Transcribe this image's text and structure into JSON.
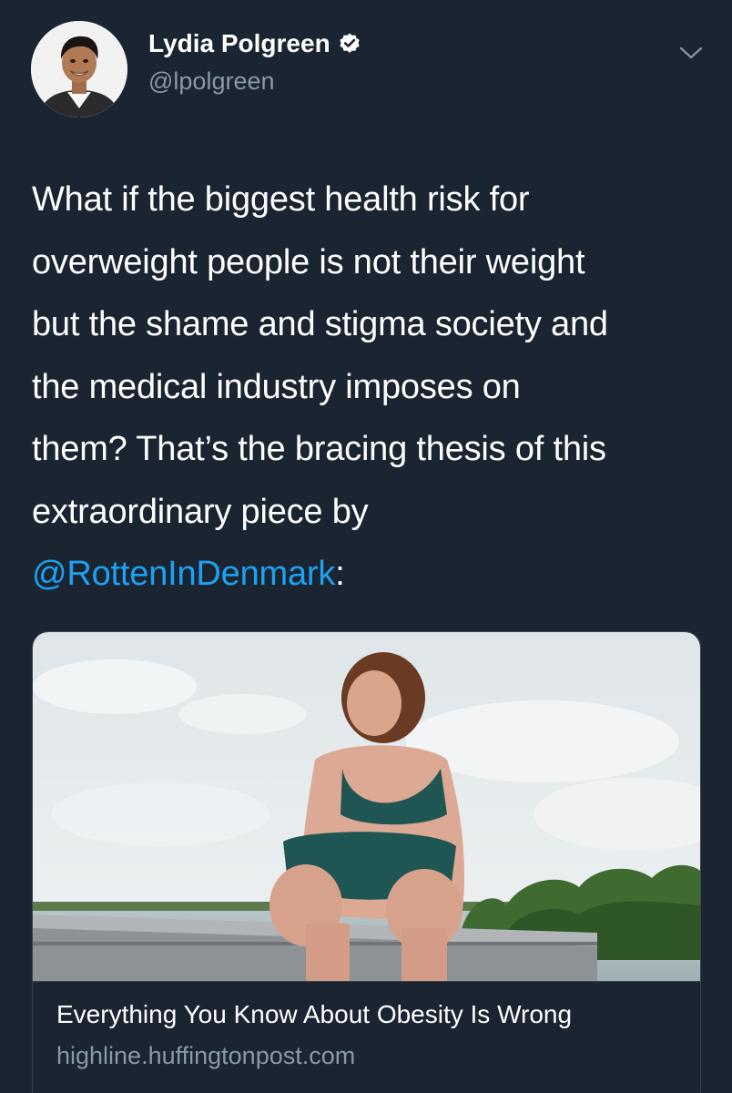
{
  "author": {
    "display_name": "Lydia Polgreen",
    "handle": "@lpolgreen",
    "verified": true,
    "avatar_icon": "profile-photo"
  },
  "tweet": {
    "lines": [
      "What if the biggest health risk for",
      "overweight people is not their weight",
      "but the shame and stigma society and",
      "the medical industry imposes on",
      "them? That’s the bracing thesis of this",
      "extraordinary piece by"
    ],
    "mention": "@RottenInDenmark",
    "mention_suffix": ":"
  },
  "card": {
    "title": "Everything You Know About Obesity Is Wrong",
    "domain": "highline.huffingtonpost.com"
  },
  "colors": {
    "background": "#1b2431",
    "link": "#1da1f2",
    "secondary_text": "#8899a6",
    "border": "#38444d"
  },
  "icons": {
    "verified": "verified-badge-icon",
    "menu": "chevron-down-icon"
  }
}
